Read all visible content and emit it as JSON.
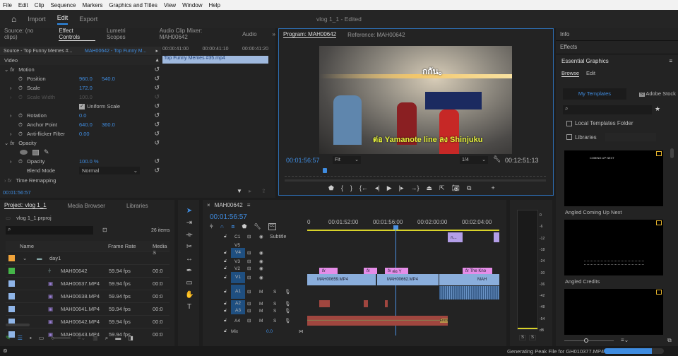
{
  "menu": [
    "File",
    "Edit",
    "Clip",
    "Sequence",
    "Markers",
    "Graphics and Titles",
    "View",
    "Window",
    "Help"
  ],
  "workspaces": {
    "import": "Import",
    "edit": "Edit",
    "export": "Export"
  },
  "window_title": "vlog 1_1 - Edited",
  "effect_panel": {
    "tabs": [
      "Source: (no clips)",
      "Effect Controls",
      "Lumetri Scopes",
      "Audio Clip Mixer: MAH00642",
      "Audio"
    ],
    "source_label": "Source - Top Funny Memes #...",
    "sequence_label": "MAH00642 - Top Funny M...",
    "ruler": [
      "00:00:41:00",
      "00:00:41:10",
      "00:00:41:20"
    ],
    "clip_name": "Top Funny Memes #35.mp4",
    "video_header": "Video",
    "motion": "Motion",
    "position_label": "Position",
    "position_x": "960.0",
    "position_y": "540.0",
    "scale_label": "Scale",
    "scale": "172.0",
    "scale_width_label": "Scale Width",
    "scale_width": "100.0",
    "uniform_scale": "Uniform Scale",
    "rotation_label": "Rotation",
    "rotation": "0.0",
    "anchor_label": "Anchor Point",
    "anchor_x": "640.0",
    "anchor_y": "360.0",
    "antiflicker_label": "Anti-flicker Filter",
    "antiflicker": "0.00",
    "opacity_section": "Opacity",
    "opacity_label": "Opacity",
    "opacity": "100.0 %",
    "blend_label": "Blend Mode",
    "blend": "Normal",
    "time_remap": "Time Remapping",
    "timecode": "00:01:56:57"
  },
  "program": {
    "tabs": [
      "Program: MAH00642",
      "Reference: MAH00642"
    ],
    "subtitle_top": "กกัน。",
    "subtitle_bottom": "ต่อ Yamanote line ลง Shinjuku",
    "timecode": "00:01:56:57",
    "fit": "Fit",
    "resolution": "1/4",
    "duration": "00:12:51:13",
    "playhead_fraction": 0.145
  },
  "right": {
    "info": "Info",
    "effects": "Effects",
    "essential": "Essential Graphics",
    "browse": "Browse",
    "edit": "Edit",
    "my_templates": "My Templates",
    "adobe_stock": "Adobe Stock",
    "local_templates": "Local Templates Folder",
    "libraries": "Libraries",
    "templates": [
      {
        "name": "Angled Coming Up Next",
        "preview": "COMING UP NEXT"
      },
      {
        "name": "Angled Credits",
        "preview": ""
      },
      {
        "name": "",
        "preview": ""
      }
    ]
  },
  "project": {
    "tabs": [
      "Project: vlog 1_1",
      "Media Browser",
      "Libraries"
    ],
    "file": "vlog 1_1.prproj",
    "items_count": "26 items",
    "columns": [
      "Name",
      "Frame Rate",
      "Media S"
    ],
    "rows": [
      {
        "name": "day1",
        "rate": "",
        "start": "",
        "color": "#f0a33a",
        "type": "folder"
      },
      {
        "name": "MAH00642",
        "rate": "59.94 fps",
        "start": "00:0",
        "color": "#45b649",
        "type": "sequence"
      },
      {
        "name": "MAH00637.MP4",
        "rate": "59.94 fps",
        "start": "00:0",
        "color": "#8fb5e8",
        "type": "clip"
      },
      {
        "name": "MAH00638.MP4",
        "rate": "59.94 fps",
        "start": "00:0",
        "color": "#8fb5e8",
        "type": "clip"
      },
      {
        "name": "MAH00641.MP4",
        "rate": "59.94 fps",
        "start": "00:0",
        "color": "#8fb5e8",
        "type": "clip"
      },
      {
        "name": "MAH00642.MP4",
        "rate": "59.94 fps",
        "start": "00:0",
        "color": "#8fb5e8",
        "type": "clip"
      },
      {
        "name": "MAH00643.MP4",
        "rate": "59.94 fps",
        "start": "00:0",
        "color": "#8fb5e8",
        "type": "clip"
      }
    ]
  },
  "timeline": {
    "sequence": "MAH00642",
    "timecode": "00:01:56:57",
    "ruler": [
      "0",
      "00:01:52:00",
      "00:01:56:00",
      "00:02:00:00",
      "00:02:04:00"
    ],
    "tracks": {
      "c1": "C1",
      "subtitle": "Subtitle",
      "v5": "V5",
      "v4": "V4",
      "v3": "V3",
      "v2": "V2",
      "v1": "V1",
      "a1": "A1",
      "a2": "A2",
      "a3": "A3",
      "a4": "A4",
      "mix": "Mix",
      "mix_value": "0.0",
      "m": "M",
      "s": "S"
    },
    "clips": {
      "sub1": "ก...",
      "fx": "fx",
      "fx_thai": "ต่อ Y",
      "fx_knock": "The Kno",
      "v1a": "MAH00659.MP4",
      "v1b": "MAH00662.MP4",
      "v1c": "MAH",
      "a4end": "Enco"
    }
  },
  "meter": {
    "scale": [
      "0",
      "-6",
      "-12",
      "-18",
      "-24",
      "-30",
      "-36",
      "-42",
      "-48",
      "-54",
      "dB"
    ],
    "solo": "S"
  },
  "status": {
    "text": "Generating Peak File for GH010377.MP4",
    "progress": 0.8
  }
}
